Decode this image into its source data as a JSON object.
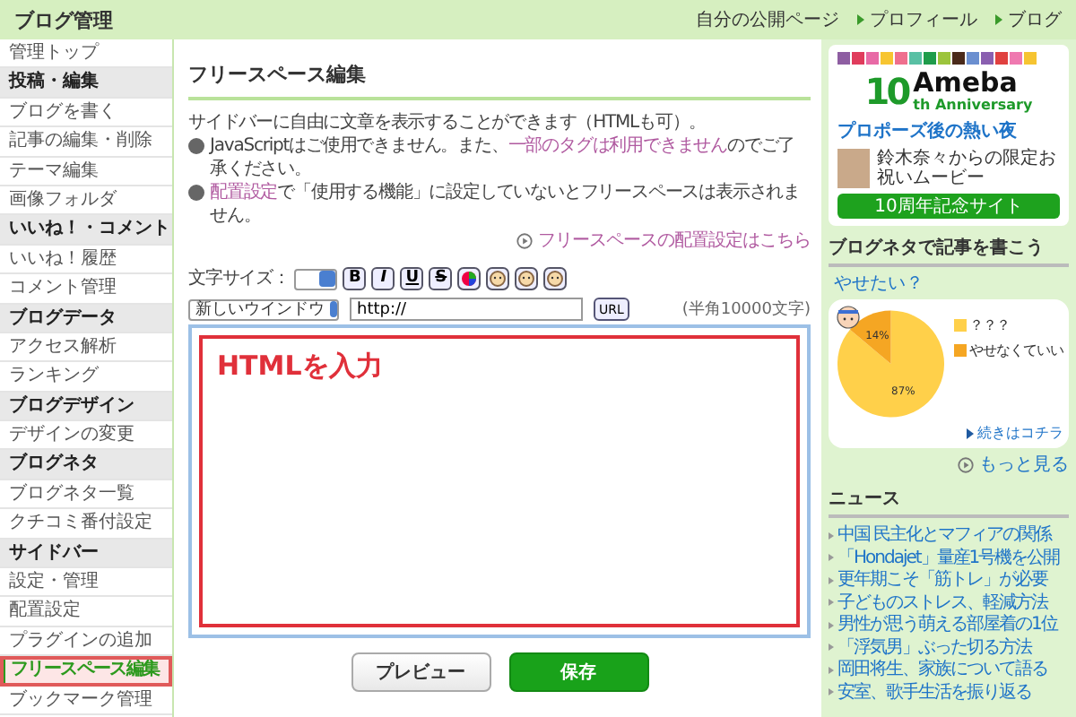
{
  "header": {
    "title": "ブログ管理",
    "links": [
      {
        "label": "自分の公開ページ",
        "kind": "plain"
      },
      {
        "label": "プロフィール",
        "kind": "arrow"
      },
      {
        "label": "ブログ",
        "kind": "arrow"
      }
    ]
  },
  "sidebar": {
    "items": [
      {
        "label": "管理トップ",
        "kind": "item",
        "selected": false
      },
      {
        "label": "投稿・編集",
        "kind": "heading"
      },
      {
        "label": "ブログを書く",
        "kind": "item",
        "selected": false
      },
      {
        "label": "記事の編集・削除",
        "kind": "item",
        "selected": false
      },
      {
        "label": "テーマ編集",
        "kind": "item",
        "selected": false
      },
      {
        "label": "画像フォルダ",
        "kind": "item",
        "selected": false
      },
      {
        "label": "いいね！・コメント",
        "kind": "heading"
      },
      {
        "label": "いいね！履歴",
        "kind": "item",
        "selected": false
      },
      {
        "label": "コメント管理",
        "kind": "item",
        "selected": false
      },
      {
        "label": "ブログデータ",
        "kind": "heading"
      },
      {
        "label": "アクセス解析",
        "kind": "item",
        "selected": false
      },
      {
        "label": "ランキング",
        "kind": "item",
        "selected": false
      },
      {
        "label": "ブログデザイン",
        "kind": "heading"
      },
      {
        "label": "デザインの変更",
        "kind": "item",
        "selected": false
      },
      {
        "label": "ブログネタ",
        "kind": "heading"
      },
      {
        "label": "ブログネタ一覧",
        "kind": "item",
        "selected": false
      },
      {
        "label": "クチコミ番付設定",
        "kind": "item",
        "selected": false
      },
      {
        "label": "サイドバー",
        "kind": "heading"
      },
      {
        "label": "設定・管理",
        "kind": "item",
        "selected": false
      },
      {
        "label": "配置設定",
        "kind": "item",
        "selected": false
      },
      {
        "label": "プラグインの追加",
        "kind": "item",
        "selected": false
      },
      {
        "label": "フリースペース編集",
        "kind": "item",
        "selected": true
      },
      {
        "label": "ブックマーク管理",
        "kind": "item",
        "selected": false
      }
    ]
  },
  "editor": {
    "title": "フリースペース編集",
    "description": "サイドバーに自由に文章を表示することができます（HTMLも可）。",
    "notes": [
      {
        "parts": [
          {
            "text": "JavaScriptはご使用できません。また、",
            "kind": "text"
          },
          {
            "text": "一部のタグは利用できません",
            "kind": "link"
          },
          {
            "text": "のでご了承ください。",
            "kind": "text"
          }
        ]
      },
      {
        "parts": [
          {
            "text": "配置設定",
            "kind": "link"
          },
          {
            "text": "で「使用する機能」に設定していないとフリースペースは表示されません。",
            "kind": "text"
          }
        ]
      }
    ],
    "placement_link": "フリースペースの配置設定はこちら",
    "font_size_label": "文字サイズ：",
    "format_buttons": [
      "B",
      "I",
      "U",
      "S"
    ],
    "link_target": "新しいウインドウ",
    "url_value": "http://",
    "url_button": "URL",
    "char_limit": "(半角10000文字)",
    "content_placeholder": "HTMLを入力",
    "buttons": [
      {
        "label": "プレビュー",
        "kind": "secondary"
      },
      {
        "label": "保存",
        "kind": "primary"
      }
    ]
  },
  "ad": {
    "logo_number": "10",
    "logo_name": "Ameba",
    "logo_sub": "th Anniversary",
    "headline": "プロポーズ後の熱い夜",
    "text": "鈴木奈々からの限定お祝いムービー",
    "button": "10周年記念サイト"
  },
  "blog_neta": {
    "title": "ブログネタで記事を書こう",
    "question": "やせたい？",
    "chart_data": {
      "type": "pie",
      "categories": [
        "？？？",
        "やせなくていい"
      ],
      "values": [
        87,
        14
      ],
      "value_labels": [
        "87%",
        "14%"
      ]
    },
    "slice_colors": [
      {
        "color": "#ffd04a"
      },
      {
        "color": "#f5a623"
      }
    ],
    "more_link": "続きはコチラ",
    "see_more": "もっと見る"
  },
  "news": {
    "title": "ニュース",
    "items": [
      "中国 民主化とマフィアの関係",
      "「Hondajet」量産1号機を公開",
      "更年期こそ「筋トレ」が必要",
      "子どものストレス、軽減方法",
      "男性が思う萌える部屋着の1位",
      "「浮気男」ぶった切る方法",
      "岡田将生、家族について語る",
      "安室、歌手生活を振り返る"
    ]
  }
}
